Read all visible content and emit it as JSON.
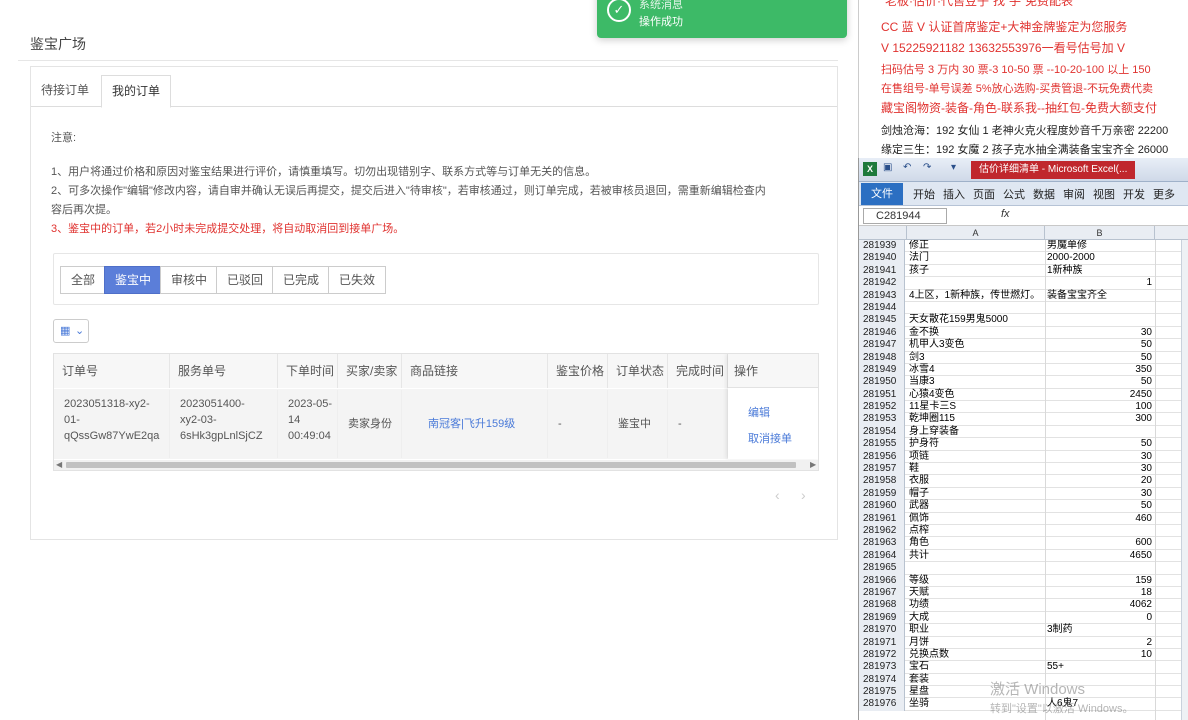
{
  "page": {
    "title": "鉴宝广场"
  },
  "tabs": [
    {
      "label": "待接订单"
    },
    {
      "label": "我的订单"
    }
  ],
  "notes": {
    "heading": "注意:",
    "line1": "1、用户将通过价格和原因对鉴宝结果进行评价，请慎重填写。切勿出现错别字、联系方式等与订单无关的信息。",
    "line2": "2、可多次操作\"编辑\"修改内容，请自审并确认无误后再提交，提交后进入\"待审核\"，若审核通过，则订单完成，若被审核员退回，需重新编辑检查内",
    "line2b": "容后再次提。",
    "line3": "3、鉴宝中的订单，若2小时未完成提交处理，将自动取消回到接单广场。"
  },
  "filters": [
    {
      "label": "全部"
    },
    {
      "label": "鉴宝中"
    },
    {
      "label": "审核中"
    },
    {
      "label": "已驳回"
    },
    {
      "label": "已完成"
    },
    {
      "label": "已失效"
    }
  ],
  "table": {
    "headers": [
      "订单号",
      "服务单号",
      "下单时间",
      "买家/卖家",
      "商品链接",
      "鉴宝价格",
      "订单状态",
      "完成时间",
      "操作"
    ],
    "row": {
      "order_no": [
        "2023051318-xy2-",
        "01-",
        "qQssGw87YwE2qa"
      ],
      "service_no": [
        "2023051400-",
        "xy2-03-",
        "6sHk3gpLnlSjCZ"
      ],
      "time": [
        "2023-05-",
        "14",
        "00:49:04"
      ],
      "role": "卖家身份",
      "link": "南冠客|飞升159级",
      "price": "-",
      "status": "鉴宝中",
      "done_time": "-",
      "actions": [
        "编辑",
        "取消接单"
      ]
    }
  },
  "pager": {
    "prev": "‹",
    "next": "›"
  },
  "toast": {
    "title": "系统消息",
    "message": "操作成功"
  },
  "ad": {
    "line0": "“老板·估价·代售豆子”找“手”免费配表",
    "line1": "CC 蓝 V 认证首席鉴定+大神金牌鉴定为您服务",
    "line2": "V 15225921182    13632553976一看号估号加 V",
    "line3": "扫码估号 3 万内 30 票-3 10-50 票 --10-20-100 以上 150",
    "line4": "在售组号-单号误差 5%放心选购-买贵管退-不玩免费代卖",
    "line5": "藏宝阁物资-装备-角色-联系我--抽红包-免费大额支付",
    "line6": "剑烛沧海：192 女仙 1 老神火克火程度妙音千万亲密 22200",
    "line7": "缘定三生：192 女魔 2 孩子克水抽全满装备宝宝齐全 26000"
  },
  "excel": {
    "doc_title": "估价详细清单 - Microsoft Excel(...",
    "menu": [
      "开始",
      "插入",
      "页面",
      "公式",
      "数据",
      "审阅",
      "视图",
      "开发",
      "更多"
    ],
    "file_label": "文件",
    "name_box": "C281944",
    "fx": "fx",
    "col_a": "A",
    "col_b": "B",
    "rows": [
      {
        "n": "281939",
        "a": "修正",
        "b": "男魔单修"
      },
      {
        "n": "281940",
        "a": "法门",
        "b": "2000-2000"
      },
      {
        "n": "281941",
        "a": "孩子",
        "b": "1新种族"
      },
      {
        "n": "281942",
        "a": "",
        "b": "1"
      },
      {
        "n": "281943",
        "a": "4上区，1新种族，传世燃灯。",
        "b": "装备宝宝齐全"
      },
      {
        "n": "281944",
        "a": "",
        "b": ""
      },
      {
        "n": "281945",
        "a": "天女散花159男鬼5000",
        "b": ""
      },
      {
        "n": "281946",
        "a": "金不换",
        "b": "30"
      },
      {
        "n": "281947",
        "a": "机甲人3变色",
        "b": "50"
      },
      {
        "n": "281948",
        "a": "剑3",
        "b": "50"
      },
      {
        "n": "281949",
        "a": "冰雪4",
        "b": "350"
      },
      {
        "n": "281950",
        "a": "当康3",
        "b": "50"
      },
      {
        "n": "281951",
        "a": "心猿4变色",
        "b": "2450"
      },
      {
        "n": "281952",
        "a": "11星卡三S",
        "b": "100"
      },
      {
        "n": "281953",
        "a": "乾坤圈115",
        "b": "300"
      },
      {
        "n": "281954",
        "a": "身上穿装备",
        "b": ""
      },
      {
        "n": "281955",
        "a": "护身符",
        "b": "50"
      },
      {
        "n": "281956",
        "a": "项链",
        "b": "30"
      },
      {
        "n": "281957",
        "a": "鞋",
        "b": "30"
      },
      {
        "n": "281958",
        "a": "衣服",
        "b": "20"
      },
      {
        "n": "281959",
        "a": "帽子",
        "b": "30"
      },
      {
        "n": "281960",
        "a": "武器",
        "b": "50"
      },
      {
        "n": "281961",
        "a": "佩饰",
        "b": "460"
      },
      {
        "n": "281962",
        "a": "点榨",
        "b": ""
      },
      {
        "n": "281963",
        "a": "角色",
        "b": "600"
      },
      {
        "n": "281964",
        "a": "共计",
        "b": "4650"
      },
      {
        "n": "281965",
        "a": "",
        "b": ""
      },
      {
        "n": "281966",
        "a": "等级",
        "b": "159"
      },
      {
        "n": "281967",
        "a": "天赋",
        "b": "18"
      },
      {
        "n": "281968",
        "a": "功绩",
        "b": "4062"
      },
      {
        "n": "281969",
        "a": "大成",
        "b": "0"
      },
      {
        "n": "281970",
        "a": "职业",
        "b": "3制药"
      },
      {
        "n": "281971",
        "a": "月饼",
        "b": "2"
      },
      {
        "n": "281972",
        "a": "兑换点数",
        "b": "10"
      },
      {
        "n": "281973",
        "a": "宝石",
        "b": "55+"
      },
      {
        "n": "281974",
        "a": "套装",
        "b": ""
      },
      {
        "n": "281975",
        "a": "星盘",
        "b": ""
      },
      {
        "n": "281976",
        "a": "坐骑",
        "b": "人6鬼7"
      }
    ]
  },
  "watermark": {
    "line1": "激活 Windows",
    "line2": "转到\"设置\"以激活 Windows。"
  }
}
